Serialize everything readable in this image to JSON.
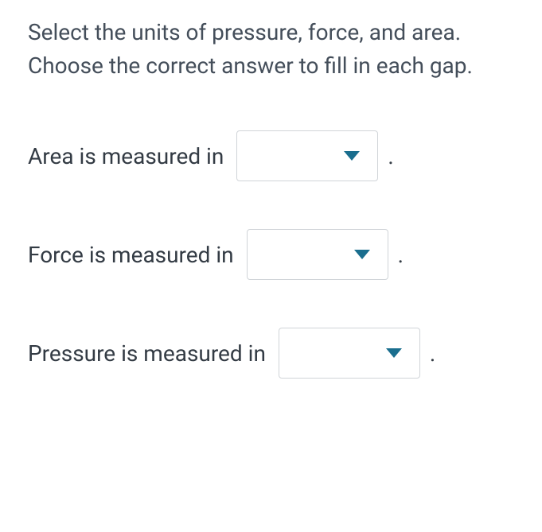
{
  "instruction": {
    "line1": "Select the units of pressure, force, and area.",
    "line2": "Choose the correct answer to fill in each gap."
  },
  "questions": [
    {
      "label": "Area is measured in",
      "selected": "",
      "period": "."
    },
    {
      "label": "Force is measured in",
      "selected": "",
      "period": "."
    },
    {
      "label": "Pressure is measured in",
      "selected": "",
      "period": "."
    }
  ]
}
